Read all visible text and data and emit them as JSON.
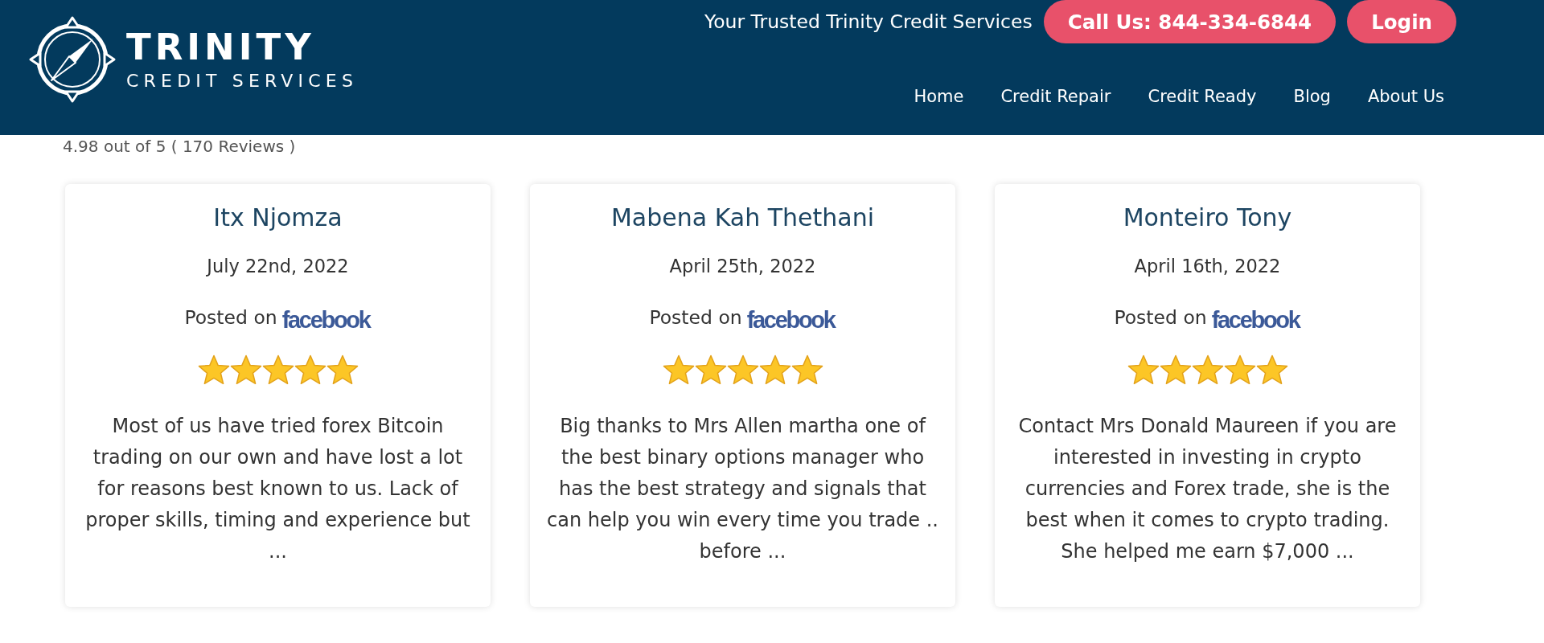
{
  "header": {
    "logo": {
      "title": "TRINITY",
      "subtitle": "CREDIT SERVICES"
    },
    "tagline": "Your Trusted Trinity Credit Services",
    "call_button": {
      "label": "Call Us: 844-334-6844"
    },
    "login_button": {
      "label": "Login"
    },
    "nav": [
      {
        "label": "Home"
      },
      {
        "label": "Credit Repair"
      },
      {
        "label": "Credit Ready"
      },
      {
        "label": "Blog"
      },
      {
        "label": "About Us"
      }
    ]
  },
  "rating_summary": "4.98 out of 5 ( 170 Reviews )",
  "reviews": [
    {
      "name": "Itx Njomza",
      "date": "July 22nd, 2022",
      "posted_label": "Posted on",
      "platform": "facebook",
      "stars": 5,
      "text": "Most of us have tried forex Bitcoin trading on our own and have lost a lot for reasons best known to us. Lack of proper skills, timing and experience but ..."
    },
    {
      "name": "Mabena Kah Thethani",
      "date": "April 25th, 2022",
      "posted_label": "Posted on",
      "platform": "facebook",
      "stars": 5,
      "text": "Big thanks to Mrs Allen martha one of the best binary options manager who has the best strategy and signals that can help you win every time you trade .. before ..."
    },
    {
      "name": "Monteiro Tony",
      "date": "April 16th, 2022",
      "posted_label": "Posted on",
      "platform": "facebook",
      "stars": 5,
      "text": "Contact Mrs Donald Maureen if you are interested in investing in crypto currencies and Forex trade, she is the best when it comes to crypto trading. She helped me earn $7,000 ..."
    }
  ]
}
